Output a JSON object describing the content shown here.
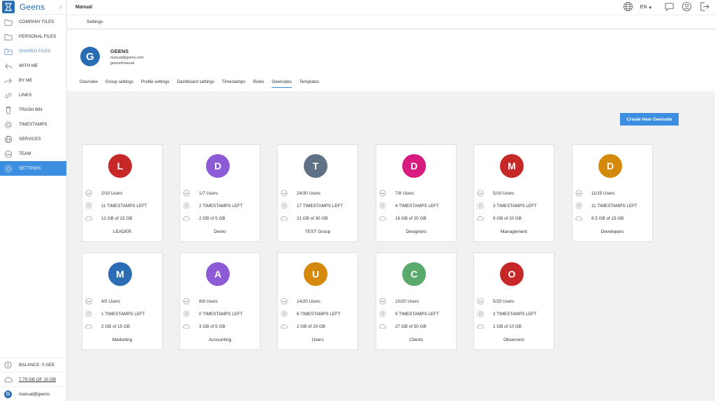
{
  "app": {
    "logo_text": "Geens",
    "brand_color": "#2a6db5",
    "accent_color": "#3c8fe0"
  },
  "sidebar": {
    "items": [
      {
        "label": "COMPANY FILES",
        "icon": "folder-icon",
        "state": "normal"
      },
      {
        "label": "PERSONAL FILES",
        "icon": "folder-icon",
        "state": "normal"
      },
      {
        "label": "SHARED FILES",
        "icon": "shared-folder-icon",
        "state": "muted"
      },
      {
        "label": "WITH ME",
        "icon": "reply-icon",
        "state": "normal"
      },
      {
        "label": "BY ME",
        "icon": "forward-icon",
        "state": "normal"
      },
      {
        "label": "LINKS",
        "icon": "link-icon",
        "state": "normal"
      },
      {
        "label": "TRASH BIN",
        "icon": "trash-icon",
        "state": "normal"
      },
      {
        "label": "TIMESTAMPS",
        "icon": "timestamp-icon",
        "state": "normal"
      },
      {
        "label": "SERVICES",
        "icon": "globe-icon",
        "state": "normal"
      },
      {
        "label": "TEAM",
        "icon": "team-icon",
        "state": "normal"
      },
      {
        "label": "SETTINGS",
        "icon": "gear-icon",
        "state": "active"
      }
    ],
    "footer": {
      "balance": "BALANCE: 0 GEE",
      "storage": "7.79 GB OF 10 GB",
      "user": "manual@geens",
      "user_initial": "G"
    }
  },
  "topbar": {
    "title": "Manual",
    "language": "EN"
  },
  "subbar": {
    "label": "Settings"
  },
  "group": {
    "initial": "G",
    "name": "GEENS",
    "email": "manual@geens.com",
    "id": "geens#manual"
  },
  "tabs": [
    {
      "label": "Overview",
      "active": false
    },
    {
      "label": "Group settings",
      "active": false
    },
    {
      "label": "Profile settings",
      "active": false
    },
    {
      "label": "Dashboard settings",
      "active": false
    },
    {
      "label": "Timestamps",
      "active": false
    },
    {
      "label": "Roles",
      "active": false
    },
    {
      "label": "Geenodes",
      "active": true
    },
    {
      "label": "Templates",
      "active": false
    }
  ],
  "create_button": "Create New Geenode",
  "geenodes": [
    {
      "initial": "L",
      "color": "#c62828",
      "users": "2/10 Users",
      "timestamps": "11 TIMESTAMPS LEFT",
      "storage": "12 GB of 15 GB",
      "name": "LEADER"
    },
    {
      "initial": "D",
      "color": "#8e5bd6",
      "users": "1/7 Users",
      "timestamps": "2 TIMESTAMPS LEFT",
      "storage": "2 GB of 5 GB",
      "name": "Demo"
    },
    {
      "initial": "T",
      "color": "#5f7285",
      "users": "24/30 Users",
      "timestamps": "17 TIMESTAMPS LEFT",
      "storage": "21 GB of 30 GB",
      "name": "TEST Group"
    },
    {
      "initial": "D",
      "color": "#d81b7f",
      "users": "7/8 Users",
      "timestamps": "4 TIMESTAMPS LEFT",
      "storage": "16 GB of 20 GB",
      "name": "Designers"
    },
    {
      "initial": "M",
      "color": "#c62828",
      "users": "5/10 Users",
      "timestamps": "3 TIMESTAMPS LEFT",
      "storage": "9 GB of 20 GB",
      "name": "Management"
    },
    {
      "initial": "D",
      "color": "#d4890a",
      "users": "11/15 Users",
      "timestamps": "11 TIMESTAMPS LEFT",
      "storage": "8.5 GB of 15 GB",
      "name": "Developers"
    },
    {
      "initial": "M",
      "color": "#2a6db5",
      "users": "4/5 Users",
      "timestamps": "1 TIMESTAMPS LEFT",
      "storage": "2 GB of 15 GB",
      "name": "Marketing"
    },
    {
      "initial": "A",
      "color": "#8e5bd6",
      "users": "8/8 Users",
      "timestamps": "0 TIMESTAMPS LEFT",
      "storage": "3 GB of 5 GB",
      "name": "Accounting"
    },
    {
      "initial": "U",
      "color": "#d4890a",
      "users": "14/20 Users",
      "timestamps": "6 TIMESTAMPS LEFT",
      "storage": "2 GB of 20 GB",
      "name": "Users"
    },
    {
      "initial": "C",
      "color": "#5aaa6e",
      "users": "10/20 Users",
      "timestamps": "9 TIMESTAMPS LEFT",
      "storage": "27 GB of 50 GB",
      "name": "Clients"
    },
    {
      "initial": "O",
      "color": "#c62828",
      "users": "5/20 Users",
      "timestamps": "2 TIMESTAMPS LEFT",
      "storage": "1 GB of 10 GB",
      "name": "Observers"
    }
  ]
}
